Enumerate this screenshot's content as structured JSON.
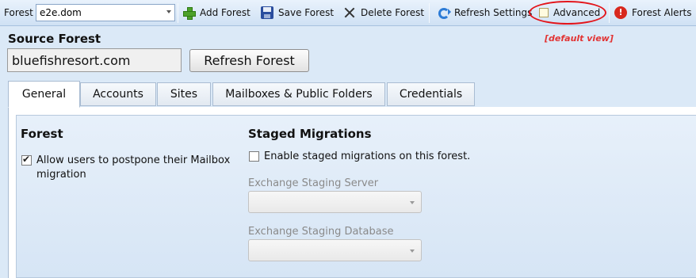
{
  "toolbar": {
    "forest_label": "Forest",
    "forest_value": "e2e.dom",
    "add_forest": "Add Forest",
    "save_forest": "Save Forest",
    "delete_forest": "Delete Forest",
    "refresh_settings": "Refresh Settings",
    "advanced": "Advanced",
    "forest_alerts": "Forest Alerts",
    "alert_glyph": "!"
  },
  "annotation": {
    "default_view": "[default view]",
    "highlight_color": "#e3141a"
  },
  "source_forest": {
    "title": "Source Forest",
    "value": "bluefishresort.com",
    "refresh_button": "Refresh Forest"
  },
  "tabs": [
    {
      "label": "General",
      "active": true
    },
    {
      "label": "Accounts",
      "active": false
    },
    {
      "label": "Sites",
      "active": false
    },
    {
      "label": "Mailboxes & Public Folders",
      "active": false
    },
    {
      "label": "Credentials",
      "active": false
    }
  ],
  "general": {
    "forest_section": {
      "title": "Forest",
      "postpone_checked": true,
      "postpone_label_line1": "Allow users to postpone their Mailbox",
      "postpone_label_line2": "migration"
    },
    "staged_section": {
      "title": "Staged Migrations",
      "enable_checked": false,
      "enable_label": "Enable staged migrations on this forest.",
      "server_label": "Exchange Staging Server",
      "server_value": "",
      "database_label": "Exchange Staging Database",
      "database_value": ""
    }
  }
}
